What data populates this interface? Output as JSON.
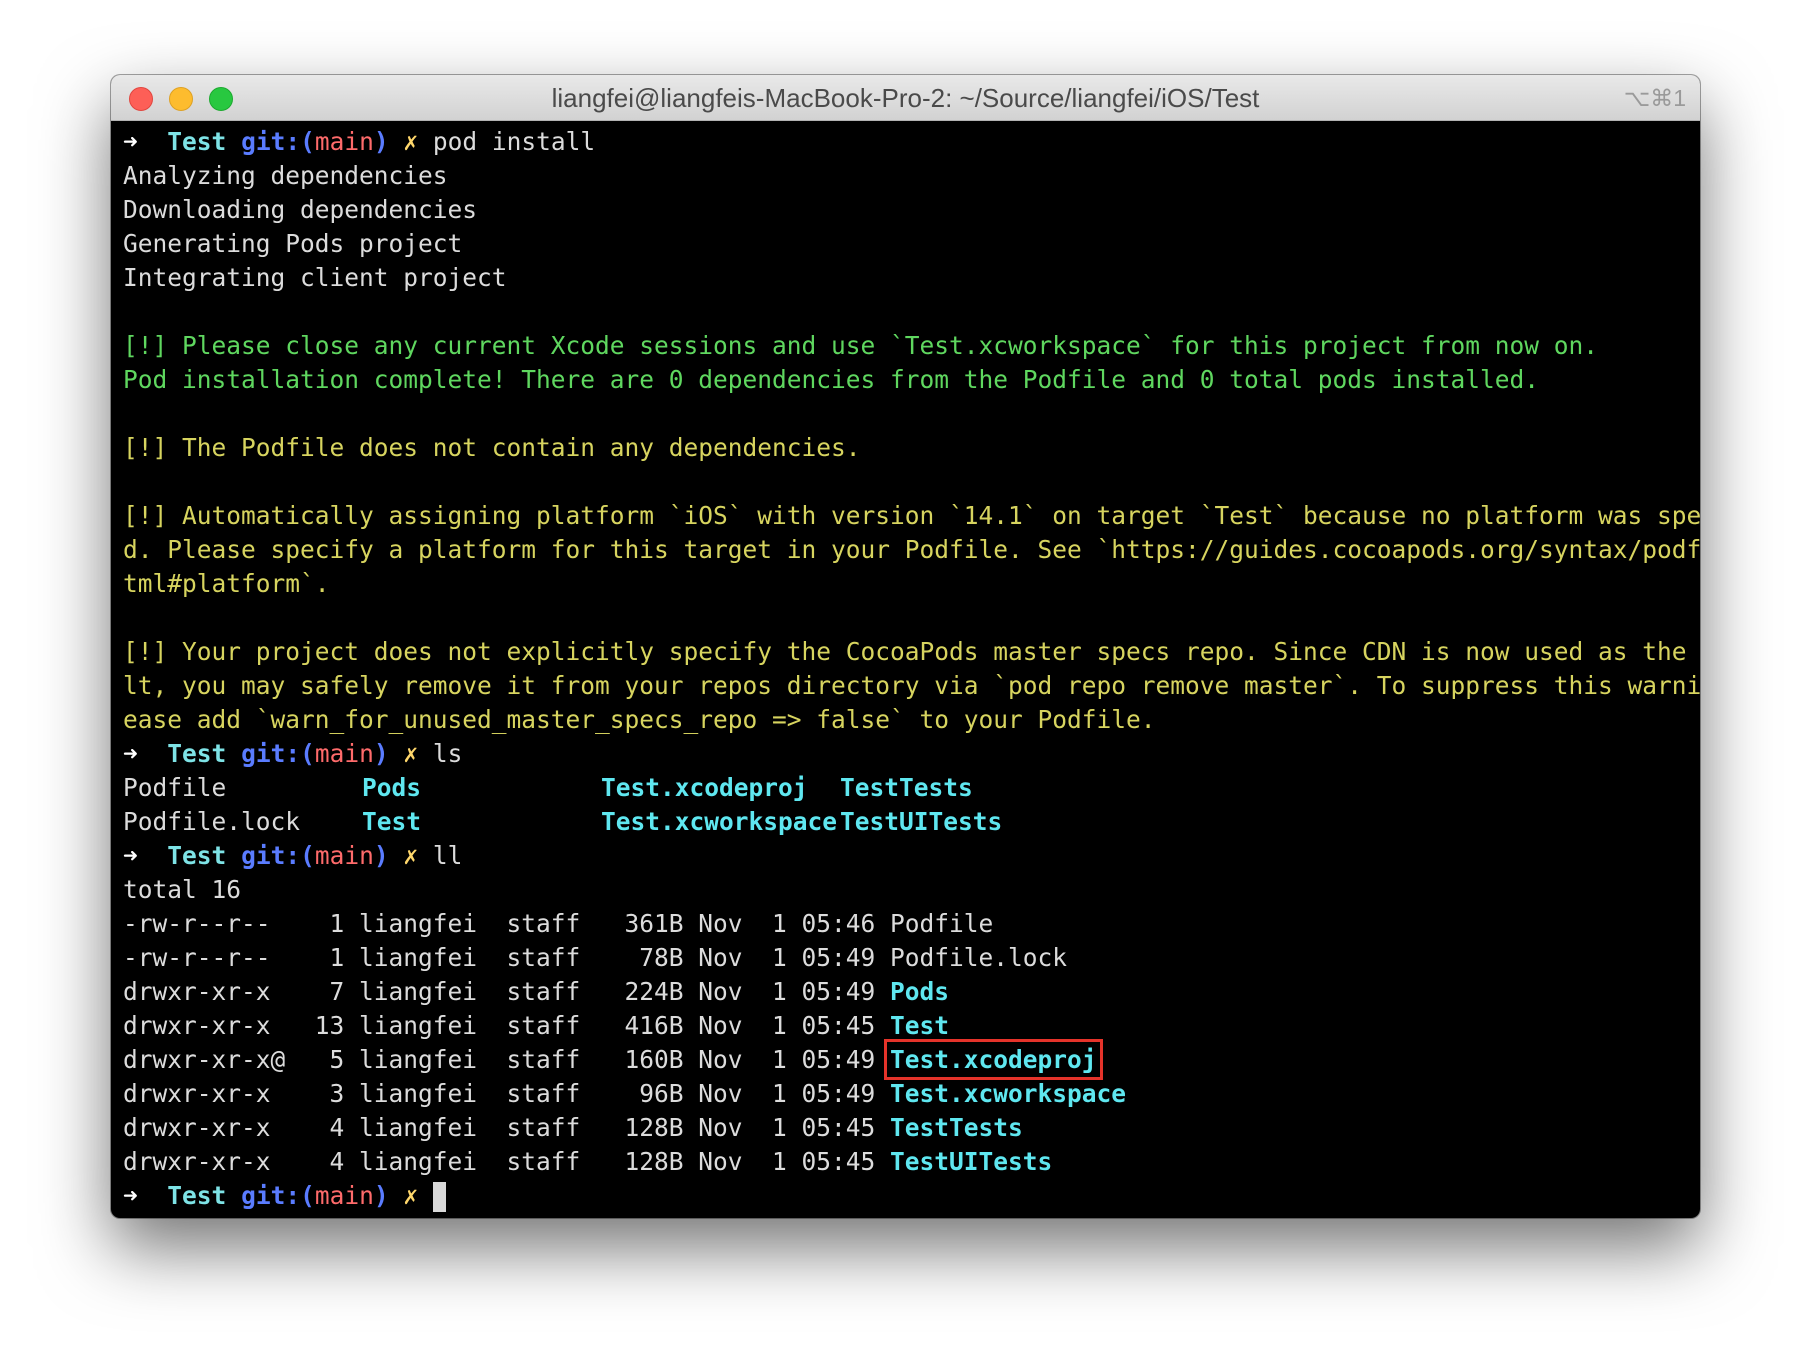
{
  "window": {
    "title": "liangfei@liangfeis-MacBook-Pro-2: ~/Source/liangfei/iOS/Test",
    "shortcut": "⌥⌘1"
  },
  "prompt": {
    "arrow": "➜",
    "dir": "Test",
    "git_label": "git:(",
    "branch": "main",
    "git_close": ")",
    "dirty": "✗"
  },
  "commands": {
    "install": "pod install",
    "ls": "ls",
    "ll": "ll"
  },
  "pod_output": {
    "steps": [
      "Analyzing dependencies",
      "Downloading dependencies",
      "Generating Pods project",
      "Integrating client project"
    ],
    "notice_1": "[!] Please close any current Xcode sessions and use `Test.xcworkspace` for this project from now on.",
    "notice_2": "Pod installation complete! There are 0 dependencies from the Podfile and 0 total pods installed.",
    "warn_1": "[!] The Podfile does not contain any dependencies.",
    "warn_2": [
      "[!] Automatically assigning platform `iOS` with version `14.1` on target `Test` because no platform was specifie",
      "d. Please specify a platform for this target in your Podfile. See `https://guides.cocoapods.org/syntax/podfile.h",
      "tml#platform`."
    ],
    "warn_3": [
      "[!] Your project does not explicitly specify the CocoaPods master specs repo. Since CDN is now used as the defau",
      "lt, you may safely remove it from your repos directory via `pod repo remove master`. To suppress this warning pl",
      "ease add `warn_for_unused_master_specs_repo => false` to your Podfile."
    ]
  },
  "ls_output": {
    "row1": [
      "Podfile",
      "Pods",
      "Test.xcodeproj",
      "TestTests"
    ],
    "row2": [
      "Podfile.lock",
      "Test",
      "Test.xcworkspace",
      "TestUITests"
    ]
  },
  "ll_output": {
    "total": "total 16",
    "rows": [
      {
        "meta": "-rw-r--r--    1 liangfei  staff   361B Nov  1 05:46 ",
        "name": "Podfile"
      },
      {
        "meta": "-rw-r--r--    1 liangfei  staff    78B Nov  1 05:49 ",
        "name": "Podfile.lock"
      },
      {
        "meta": "drwxr-xr-x    7 liangfei  staff   224B Nov  1 05:49 ",
        "name": "Pods"
      },
      {
        "meta": "drwxr-xr-x   13 liangfei  staff   416B Nov  1 05:45 ",
        "name": "Test"
      },
      {
        "meta": "drwxr-xr-x@   5 liangfei  staff   160B Nov  1 05:49 ",
        "name": "Test.xcodeproj"
      },
      {
        "meta": "drwxr-xr-x    3 liangfei  staff    96B Nov  1 05:49 ",
        "name": "Test.xcworkspace"
      },
      {
        "meta": "drwxr-xr-x    4 liangfei  staff   128B Nov  1 05:45 ",
        "name": "TestTests"
      },
      {
        "meta": "drwxr-xr-x    4 liangfei  staff   128B Nov  1 05:45 ",
        "name": "TestUITests"
      }
    ]
  },
  "colors": {
    "background": "#000000",
    "text": "#dcdcdc",
    "success": "#5fd75f",
    "warning": "#d7d45f",
    "directory": "#5fe7f0",
    "highlight_box": "#e5332a"
  }
}
